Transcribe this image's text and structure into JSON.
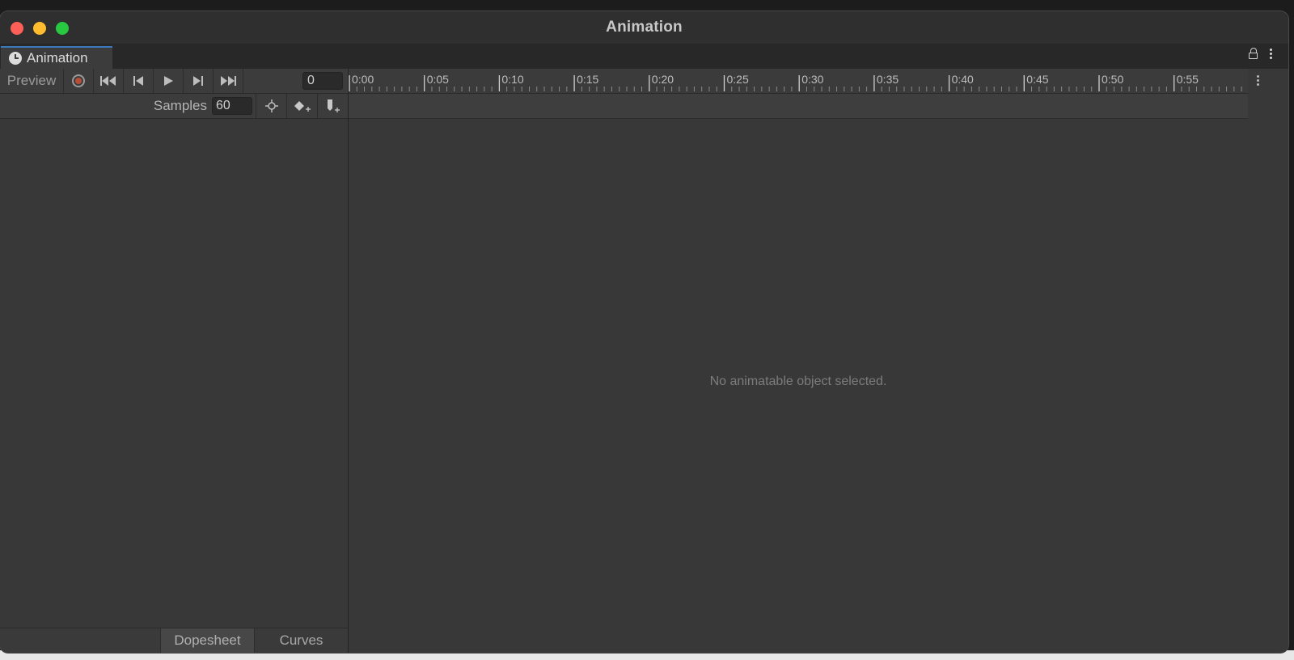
{
  "window": {
    "title": "Animation"
  },
  "tab": {
    "label": "Animation",
    "icon": "clock-icon"
  },
  "toolbar": {
    "preview_label": "Preview",
    "frame_value": "0",
    "samples_label": "Samples",
    "samples_value": "60",
    "record_color": "#b84d3a"
  },
  "timeline": {
    "ticks": [
      "0:00",
      "0:05",
      "0:10",
      "0:15",
      "0:20",
      "0:25",
      "0:30",
      "0:35",
      "0:40",
      "0:45",
      "0:50",
      "0:55"
    ]
  },
  "bottom_tabs": {
    "dopesheet": "Dopesheet",
    "curves": "Curves"
  },
  "main": {
    "empty_message": "No animatable object selected."
  }
}
